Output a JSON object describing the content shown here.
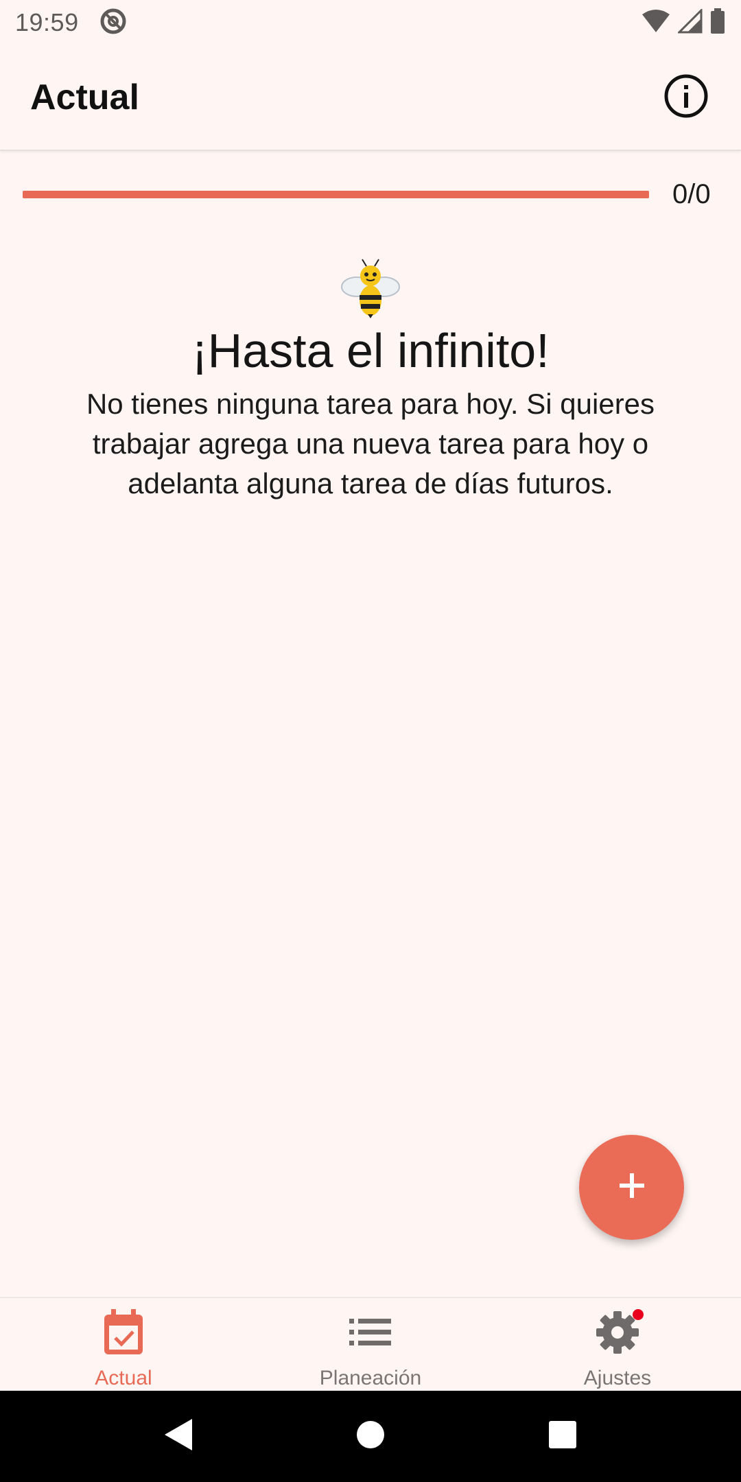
{
  "status_bar": {
    "time": "19:59"
  },
  "app_bar": {
    "title": "Actual"
  },
  "progress": {
    "count_label": "0/0",
    "fraction": 1.0
  },
  "empty_state": {
    "title": "¡Hasta el infinito!",
    "body": "No tienes ninguna tarea para hoy. Si quieres trabajar agrega una nueva tarea para hoy o adelanta alguna tarea de días futuros."
  },
  "fab": {
    "icon": "plus-icon"
  },
  "bottom_nav": {
    "items": [
      {
        "label": "Actual",
        "icon": "calendar-check-icon",
        "active": true
      },
      {
        "label": "Planeación",
        "icon": "list-icon",
        "active": false
      },
      {
        "label": "Ajustes",
        "icon": "gear-icon",
        "active": false,
        "badge": true
      }
    ]
  },
  "colors": {
    "accent": "#e86a55",
    "background": "#fff6f4",
    "badge": "#e8001c"
  }
}
